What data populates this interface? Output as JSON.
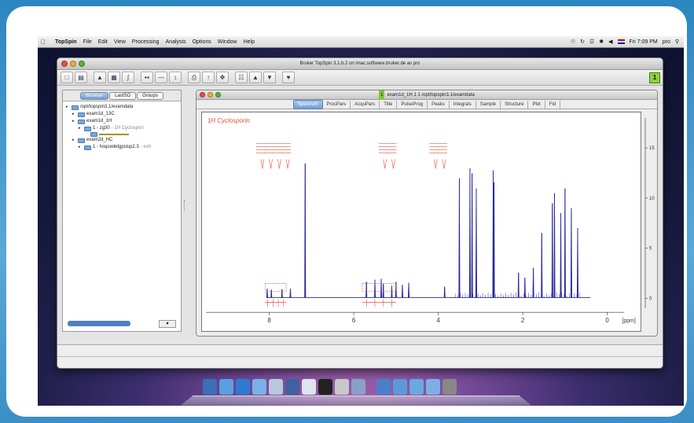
{
  "menubar": {
    "items": [
      "TopSpin",
      "File",
      "Edit",
      "View",
      "Processing",
      "Analysis",
      "Options",
      "Window",
      "Help"
    ],
    "clock": "Fri 7:09 PM",
    "user": "pro"
  },
  "app_window": {
    "title": "Bruker TopSpin 3.1.b.2 on imac.software.bruker.de as pro",
    "badge": "1"
  },
  "browser": {
    "tabs": [
      "Browser",
      "LastSO",
      "Groups"
    ],
    "active_tab": "Browser",
    "tree": [
      {
        "label": "/opt/topspin3.1/examdata",
        "sub": "",
        "depth": 0
      },
      {
        "label": "exam1d_13C",
        "sub": "",
        "depth": 1
      },
      {
        "label": "exam1d_1H",
        "sub": "",
        "depth": 1
      },
      {
        "label": "1 - zg30",
        "sub": "- 1H Cyclospori",
        "depth": 2
      },
      {
        "label": "",
        "sub": "",
        "depth": 3,
        "selected": true
      },
      {
        "label": "exam2d_HC",
        "sub": "",
        "depth": 1
      },
      {
        "label": "1 - hsqcedetgpsisp2.3",
        "sub": "- exh",
        "depth": 2
      }
    ]
  },
  "data_window": {
    "number": "1",
    "title": "exam1d_1H  1  1  /opt/topspin3.1/examdata",
    "tabs": [
      "Spectrum",
      "ProcPars",
      "AcquPars",
      "Title",
      "PulseProg",
      "Peaks",
      "Integrals",
      "Sample",
      "Structure",
      "Plot",
      "Fid"
    ],
    "active_tab": "Spectrum"
  },
  "chart_data": {
    "type": "line",
    "title": "1H Cyclosporin",
    "xlabel": "[ppm]",
    "x_ticks": [
      8,
      6,
      4,
      2,
      0
    ],
    "xlim": [
      9.5,
      -0.4
    ],
    "y_ticks": [
      0,
      5,
      10,
      15
    ],
    "ylim": [
      -1,
      18
    ],
    "line_color": "#2b2b9e",
    "label_color": "#e0503a",
    "peaks": [
      {
        "ppm": 8.05,
        "h": 0.9
      },
      {
        "ppm": 7.95,
        "h": 0.8
      },
      {
        "ppm": 7.7,
        "h": 0.85
      },
      {
        "ppm": 7.5,
        "h": 0.9
      },
      {
        "ppm": 7.15,
        "h": 13.5
      },
      {
        "ppm": 5.7,
        "h": 1.6
      },
      {
        "ppm": 5.5,
        "h": 1.8
      },
      {
        "ppm": 5.35,
        "h": 1.9
      },
      {
        "ppm": 5.3,
        "h": 1.4
      },
      {
        "ppm": 5.1,
        "h": 1.2
      },
      {
        "ppm": 5.0,
        "h": 1.6
      },
      {
        "ppm": 4.85,
        "h": 1.3
      },
      {
        "ppm": 4.7,
        "h": 1.5
      },
      {
        "ppm": 3.85,
        "h": 1.1
      },
      {
        "ppm": 3.5,
        "h": 12.0
      },
      {
        "ppm": 3.25,
        "h": 13.0
      },
      {
        "ppm": 3.2,
        "h": 12.5
      },
      {
        "ppm": 3.1,
        "h": 11.0
      },
      {
        "ppm": 2.7,
        "h": 12.8
      },
      {
        "ppm": 2.68,
        "h": 11.6
      },
      {
        "ppm": 2.1,
        "h": 2.5
      },
      {
        "ppm": 1.95,
        "h": 2.0
      },
      {
        "ppm": 1.75,
        "h": 3.0
      },
      {
        "ppm": 1.55,
        "h": 6.5
      },
      {
        "ppm": 1.3,
        "h": 9.5
      },
      {
        "ppm": 1.25,
        "h": 10.5
      },
      {
        "ppm": 1.1,
        "h": 8.5
      },
      {
        "ppm": 1.0,
        "h": 11.0
      },
      {
        "ppm": 0.85,
        "h": 9.0
      },
      {
        "ppm": 0.7,
        "h": 7.0
      }
    ],
    "top_label_groups_ppm": [
      [
        8.2,
        8.0,
        7.8,
        7.6
      ],
      [
        5.3,
        5.1
      ],
      [
        4.1,
        3.9
      ]
    ],
    "integral_groups_ppm": [
      [
        8.1,
        7.6
      ],
      [
        5.8,
        5.0
      ]
    ]
  }
}
